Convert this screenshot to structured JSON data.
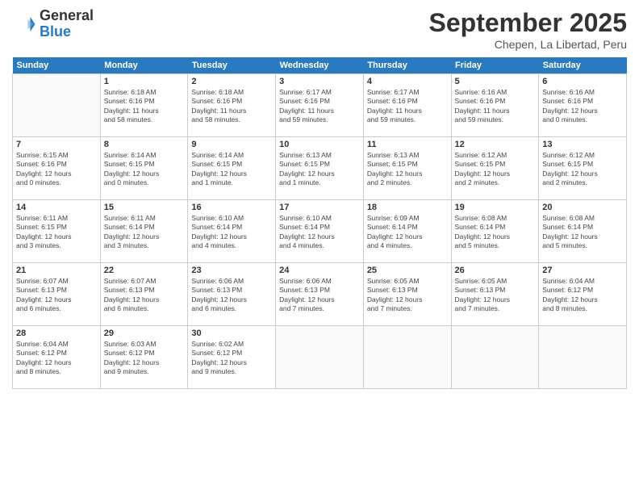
{
  "header": {
    "logo_general": "General",
    "logo_blue": "Blue",
    "month_title": "September 2025",
    "subtitle": "Chepen, La Libertad, Peru"
  },
  "weekdays": [
    "Sunday",
    "Monday",
    "Tuesday",
    "Wednesday",
    "Thursday",
    "Friday",
    "Saturday"
  ],
  "weeks": [
    [
      {
        "day": "",
        "info": ""
      },
      {
        "day": "1",
        "info": "Sunrise: 6:18 AM\nSunset: 6:16 PM\nDaylight: 11 hours\nand 58 minutes."
      },
      {
        "day": "2",
        "info": "Sunrise: 6:18 AM\nSunset: 6:16 PM\nDaylight: 11 hours\nand 58 minutes."
      },
      {
        "day": "3",
        "info": "Sunrise: 6:17 AM\nSunset: 6:16 PM\nDaylight: 11 hours\nand 59 minutes."
      },
      {
        "day": "4",
        "info": "Sunrise: 6:17 AM\nSunset: 6:16 PM\nDaylight: 11 hours\nand 59 minutes."
      },
      {
        "day": "5",
        "info": "Sunrise: 6:16 AM\nSunset: 6:16 PM\nDaylight: 11 hours\nand 59 minutes."
      },
      {
        "day": "6",
        "info": "Sunrise: 6:16 AM\nSunset: 6:16 PM\nDaylight: 12 hours\nand 0 minutes."
      }
    ],
    [
      {
        "day": "7",
        "info": "Sunrise: 6:15 AM\nSunset: 6:16 PM\nDaylight: 12 hours\nand 0 minutes."
      },
      {
        "day": "8",
        "info": "Sunrise: 6:14 AM\nSunset: 6:15 PM\nDaylight: 12 hours\nand 0 minutes."
      },
      {
        "day": "9",
        "info": "Sunrise: 6:14 AM\nSunset: 6:15 PM\nDaylight: 12 hours\nand 1 minute."
      },
      {
        "day": "10",
        "info": "Sunrise: 6:13 AM\nSunset: 6:15 PM\nDaylight: 12 hours\nand 1 minute."
      },
      {
        "day": "11",
        "info": "Sunrise: 6:13 AM\nSunset: 6:15 PM\nDaylight: 12 hours\nand 2 minutes."
      },
      {
        "day": "12",
        "info": "Sunrise: 6:12 AM\nSunset: 6:15 PM\nDaylight: 12 hours\nand 2 minutes."
      },
      {
        "day": "13",
        "info": "Sunrise: 6:12 AM\nSunset: 6:15 PM\nDaylight: 12 hours\nand 2 minutes."
      }
    ],
    [
      {
        "day": "14",
        "info": "Sunrise: 6:11 AM\nSunset: 6:15 PM\nDaylight: 12 hours\nand 3 minutes."
      },
      {
        "day": "15",
        "info": "Sunrise: 6:11 AM\nSunset: 6:14 PM\nDaylight: 12 hours\nand 3 minutes."
      },
      {
        "day": "16",
        "info": "Sunrise: 6:10 AM\nSunset: 6:14 PM\nDaylight: 12 hours\nand 4 minutes."
      },
      {
        "day": "17",
        "info": "Sunrise: 6:10 AM\nSunset: 6:14 PM\nDaylight: 12 hours\nand 4 minutes."
      },
      {
        "day": "18",
        "info": "Sunrise: 6:09 AM\nSunset: 6:14 PM\nDaylight: 12 hours\nand 4 minutes."
      },
      {
        "day": "19",
        "info": "Sunrise: 6:08 AM\nSunset: 6:14 PM\nDaylight: 12 hours\nand 5 minutes."
      },
      {
        "day": "20",
        "info": "Sunrise: 6:08 AM\nSunset: 6:14 PM\nDaylight: 12 hours\nand 5 minutes."
      }
    ],
    [
      {
        "day": "21",
        "info": "Sunrise: 6:07 AM\nSunset: 6:13 PM\nDaylight: 12 hours\nand 6 minutes."
      },
      {
        "day": "22",
        "info": "Sunrise: 6:07 AM\nSunset: 6:13 PM\nDaylight: 12 hours\nand 6 minutes."
      },
      {
        "day": "23",
        "info": "Sunrise: 6:06 AM\nSunset: 6:13 PM\nDaylight: 12 hours\nand 6 minutes."
      },
      {
        "day": "24",
        "info": "Sunrise: 6:06 AM\nSunset: 6:13 PM\nDaylight: 12 hours\nand 7 minutes."
      },
      {
        "day": "25",
        "info": "Sunrise: 6:05 AM\nSunset: 6:13 PM\nDaylight: 12 hours\nand 7 minutes."
      },
      {
        "day": "26",
        "info": "Sunrise: 6:05 AM\nSunset: 6:13 PM\nDaylight: 12 hours\nand 7 minutes."
      },
      {
        "day": "27",
        "info": "Sunrise: 6:04 AM\nSunset: 6:12 PM\nDaylight: 12 hours\nand 8 minutes."
      }
    ],
    [
      {
        "day": "28",
        "info": "Sunrise: 6:04 AM\nSunset: 6:12 PM\nDaylight: 12 hours\nand 8 minutes."
      },
      {
        "day": "29",
        "info": "Sunrise: 6:03 AM\nSunset: 6:12 PM\nDaylight: 12 hours\nand 9 minutes."
      },
      {
        "day": "30",
        "info": "Sunrise: 6:02 AM\nSunset: 6:12 PM\nDaylight: 12 hours\nand 9 minutes."
      },
      {
        "day": "",
        "info": ""
      },
      {
        "day": "",
        "info": ""
      },
      {
        "day": "",
        "info": ""
      },
      {
        "day": "",
        "info": ""
      }
    ]
  ]
}
